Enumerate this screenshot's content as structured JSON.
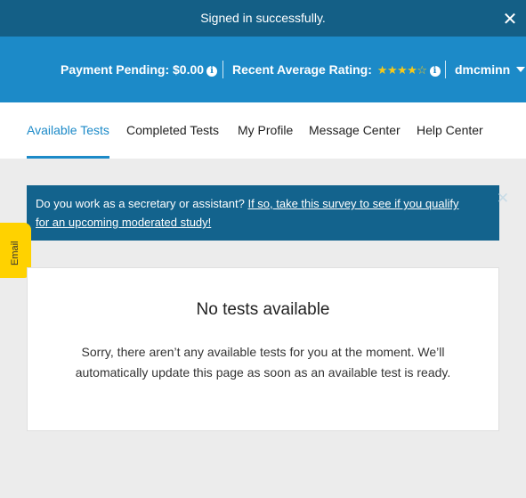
{
  "flash": {
    "message": "Signed in successfully.",
    "close_label": "✕"
  },
  "topbar": {
    "payment_label": "Payment Pending: $0.00",
    "rating_label": "Recent Average Rating:",
    "rating_stars": 4,
    "rating_max": 5,
    "username": "dmcminn",
    "info_glyph": "i"
  },
  "nav": {
    "tabs": [
      {
        "label": "Available Tests"
      },
      {
        "label": "Completed Tests"
      },
      {
        "label": "My Profile"
      },
      {
        "label": "Message Center"
      },
      {
        "label": "Help Center"
      }
    ]
  },
  "banner": {
    "text": "Do you work as a secretary or assistant?",
    "link": "If so, take this survey to see if you qualify for an upcoming moderated study!",
    "close_label": "✕"
  },
  "email_tab": {
    "label": "Email"
  },
  "empty_state": {
    "title": "No tests available",
    "message": "Sorry, there aren’t any available tests for you at the moment. We’ll automatically update this page as soon as an available test is ready."
  },
  "colors": {
    "flash_bg": "#145f86",
    "topbar_bg": "#1c8ac8",
    "accent": "#1c8ac8",
    "banner_bg": "#13638d",
    "email_tab": "#ffd200",
    "star": "#f5c91a"
  }
}
